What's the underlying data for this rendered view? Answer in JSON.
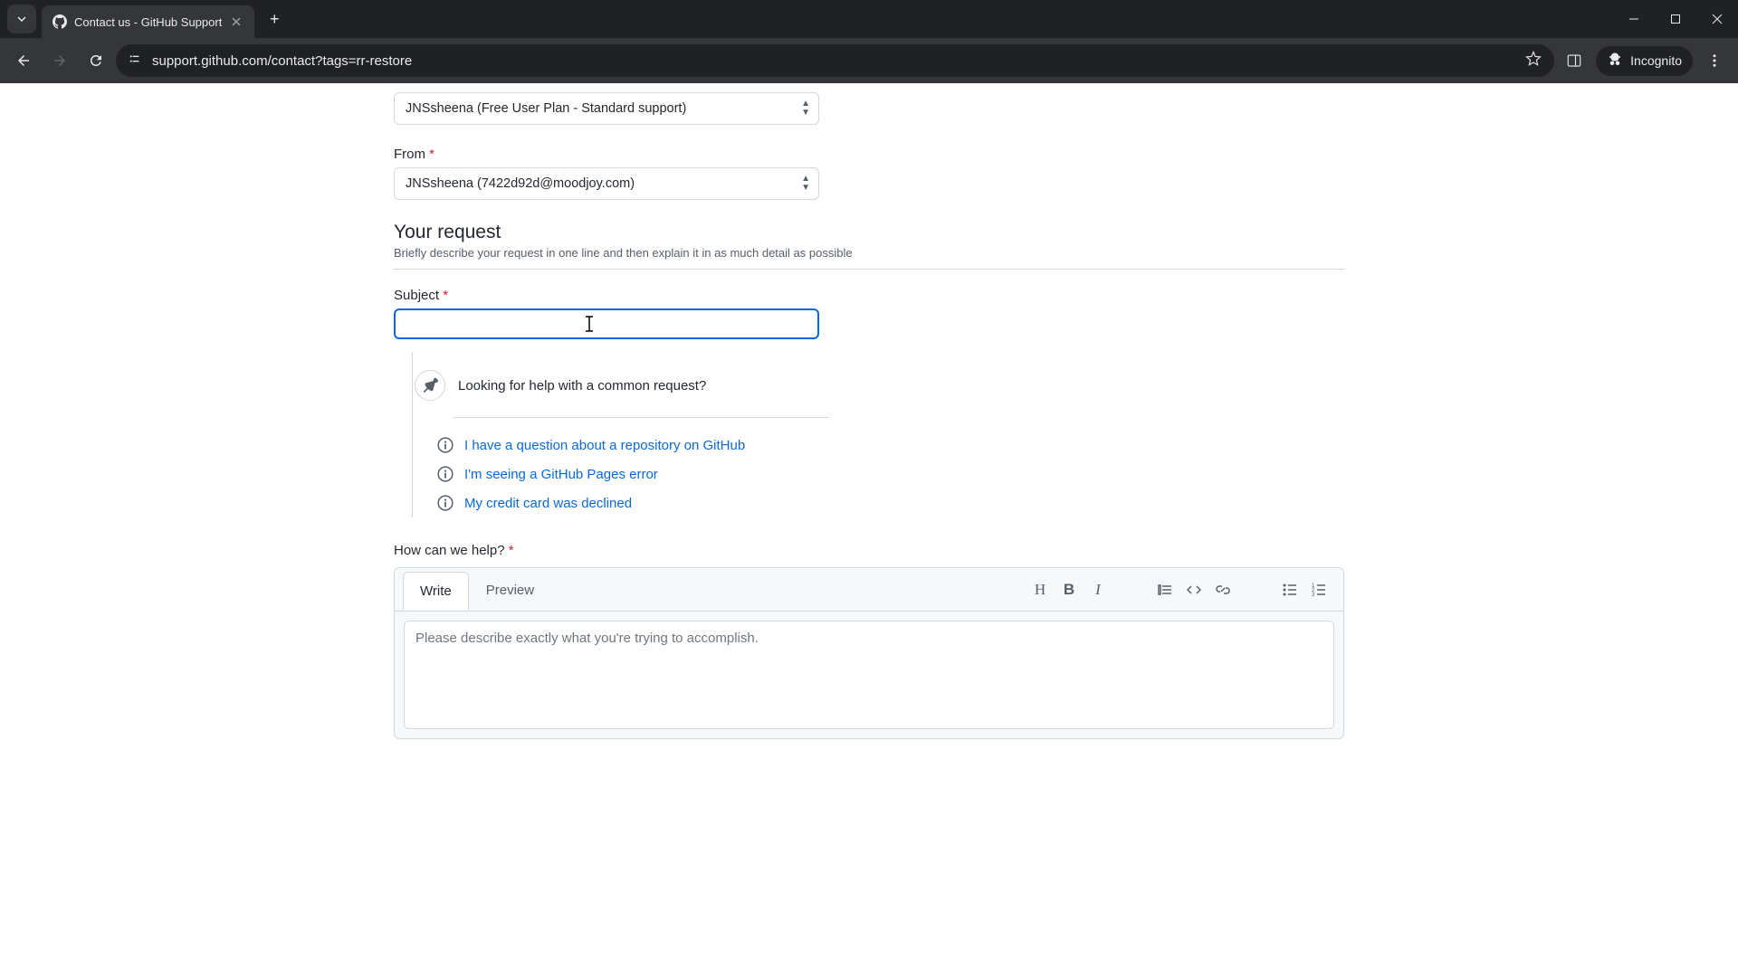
{
  "browser": {
    "tab_title": "Contact us - GitHub Support",
    "url": "support.github.com/contact?tags=rr-restore",
    "incognito_label": "Incognito"
  },
  "form": {
    "account_select": "JNSsheena (Free User Plan - Standard support)",
    "from_label": "From",
    "from_select": "JNSsheena (7422d92d@moodjoy.com)",
    "section_title": "Your request",
    "section_sub": "Briefly describe your request in one line and then explain it in as much detail as possible",
    "subject_label": "Subject",
    "suggest_head": "Looking for help with a common request?",
    "suggestions": [
      "I have a question about a repository on GitHub",
      "I'm seeing a GitHub Pages error",
      "My credit card was declined"
    ],
    "help_label": "How can we help?",
    "tabs": {
      "write": "Write",
      "preview": "Preview"
    },
    "placeholder": "Please describe exactly what you're trying to accomplish."
  }
}
